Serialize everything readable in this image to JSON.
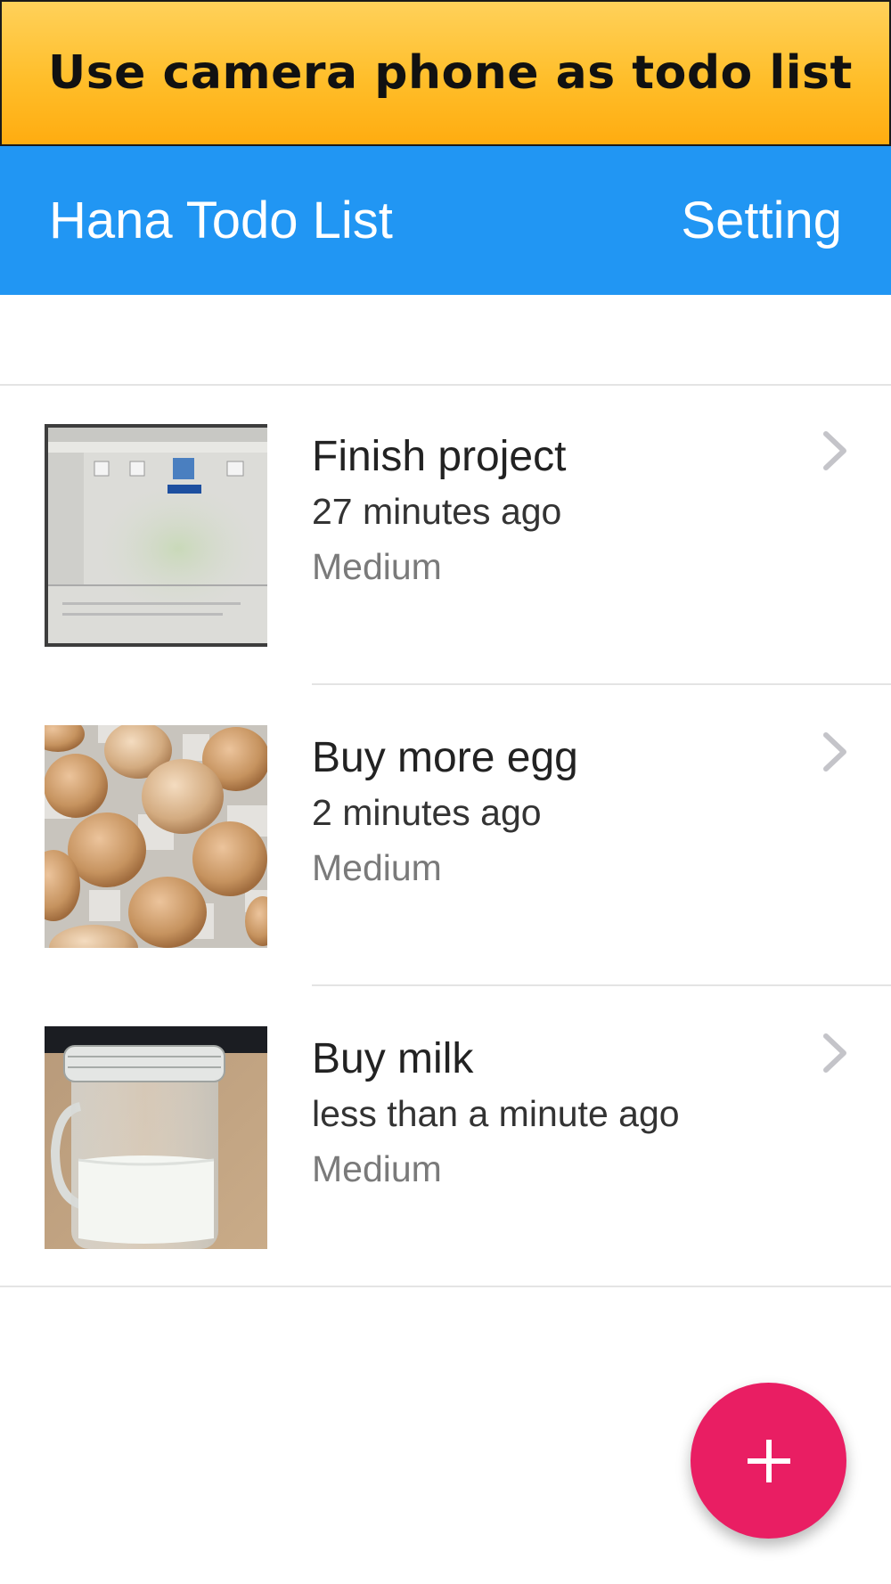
{
  "banner": {
    "text": "Use camera phone as todo list"
  },
  "app_bar": {
    "title": "Hana Todo List",
    "setting_label": "Setting"
  },
  "todos": [
    {
      "title": "Finish project",
      "time": "27 minutes ago",
      "priority": "Medium",
      "image": "laptop-screen-photo"
    },
    {
      "title": "Buy more egg",
      "time": "2 minutes ago",
      "priority": "Medium",
      "image": "eggs-carton-photo"
    },
    {
      "title": "Buy milk",
      "time": "less than a minute ago",
      "priority": "Medium",
      "image": "milk-jar-photo"
    }
  ],
  "fab": {
    "icon": "plus-icon",
    "color": "#e91e63"
  },
  "colors": {
    "banner": "#ffbe2a",
    "app_bar": "#2196f3",
    "fab": "#e91e63"
  }
}
